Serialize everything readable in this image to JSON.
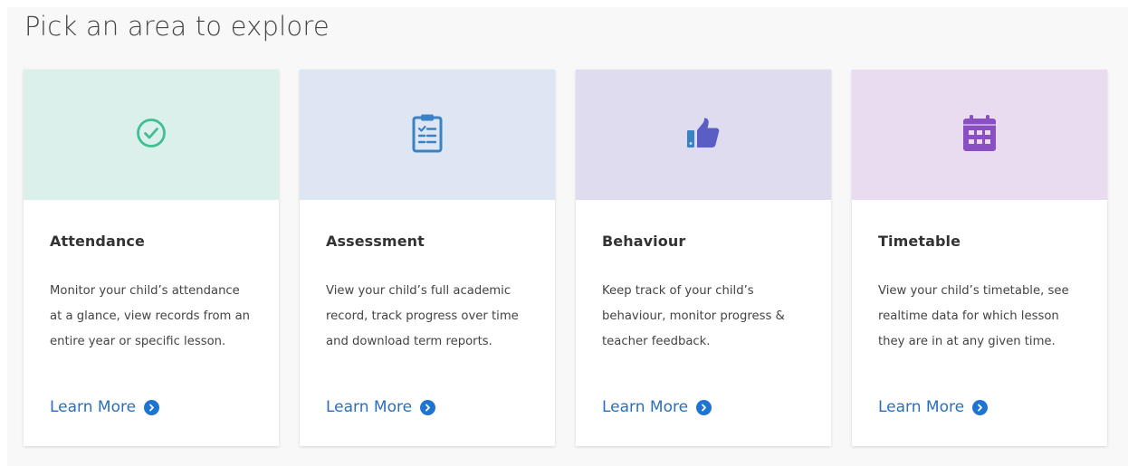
{
  "page": {
    "title": "Pick an area to explore"
  },
  "cards": [
    {
      "id": "attendance",
      "icon": "check-circle-icon",
      "header_color": "#dbf0ea",
      "icon_color": "#3fbf92",
      "title": "Attendance",
      "description": "Monitor your child’s attendance at a glance, view records from an entire year or specific lesson.",
      "link_label": "Learn More"
    },
    {
      "id": "assessment",
      "icon": "clipboard-checklist-icon",
      "header_color": "#dfe6f3",
      "icon_color": "#3a82c6",
      "title": "Assessment",
      "description": "View your child’s full academic record, track progress over time and download term reports.",
      "link_label": "Learn More"
    },
    {
      "id": "behaviour",
      "icon": "thumbs-up-icon",
      "header_color": "#dfdcf0",
      "icon_color": "#5a5dc4",
      "title": "Behaviour",
      "description": "Keep track of your child’s behaviour, monitor progress & teacher feedback.",
      "link_label": "Learn More"
    },
    {
      "id": "timetable",
      "icon": "calendar-icon",
      "header_color": "#eadcf0",
      "icon_color": "#8a4fc3",
      "title": "Timetable",
      "description": "View your child’s timetable, see realtime data for which lesson they are in at any given time.",
      "link_label": "Learn More"
    }
  ],
  "link_color": "#2a6fb8"
}
